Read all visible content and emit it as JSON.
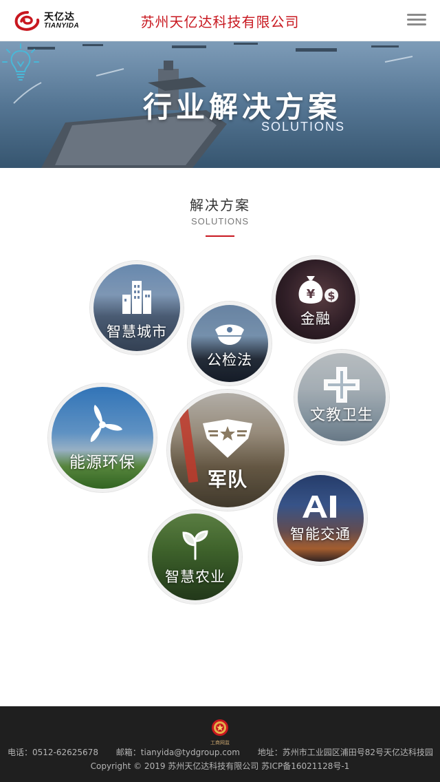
{
  "header": {
    "logo_cn": "天亿达",
    "logo_en": "TIANYIDA",
    "company_name": "苏州天亿达科技有限公司",
    "menu_icon": "hamburger-menu-icon"
  },
  "banner": {
    "title": "行业解决方案",
    "subtitle": "SOLUTIONS",
    "icon": "lightbulb-icon"
  },
  "section": {
    "title": "解决方案",
    "subtitle": "SOLUTIONS",
    "accent_color": "#c8171f"
  },
  "solutions": [
    {
      "label": "智慧城市",
      "icon": "city-buildings-icon"
    },
    {
      "label": "金融",
      "icon": "money-bag-icon"
    },
    {
      "label": "公检法",
      "icon": "police-cap-icon"
    },
    {
      "label": "文教卫生",
      "icon": "medical-cross-icon"
    },
    {
      "label": "能源环保",
      "icon": "wind-turbine-icon"
    },
    {
      "label": "军队",
      "icon": "military-emblem-icon"
    },
    {
      "label": "智能交通",
      "icon": "ai-icon"
    },
    {
      "label": "智慧农业",
      "icon": "plant-sprout-icon"
    }
  ],
  "footer": {
    "badge_text": "工商网监",
    "phone": "电话：0512-62625678",
    "email": "邮箱：tianyida@tydgroup.com",
    "address": "地址：苏州市工业园区浦田号82号天亿达科技园",
    "copyright": "Copyright © 2019 苏州天亿达科技有限公司  苏ICP备16021128号-1"
  }
}
